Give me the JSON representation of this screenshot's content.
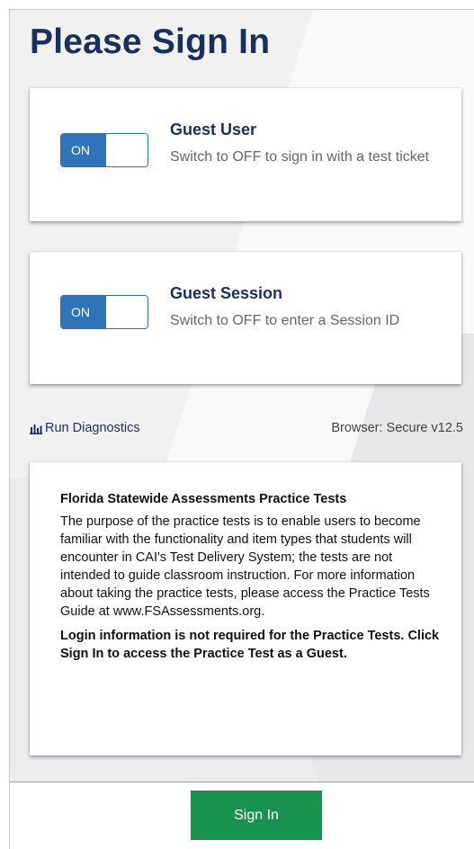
{
  "page": {
    "title": "Please Sign In"
  },
  "guest_user": {
    "toggle_label": "ON",
    "heading": "Guest User",
    "description": "Switch to OFF to sign in with a test ticket",
    "toggle_state": "on"
  },
  "guest_session": {
    "toggle_label": "ON",
    "heading": "Guest Session",
    "description": "Switch to OFF to enter a Session ID",
    "toggle_state": "on"
  },
  "status": {
    "diagnostics_label": "Run Diagnostics",
    "diagnostics_icon": "bar-chart-icon",
    "browser_info": "Browser: Secure v12.5"
  },
  "info": {
    "title": "Florida Statewide Assessments Practice Tests",
    "body": "The purpose of the practice tests is to enable users to become familiar with the functionality and item types that students will encounter in CAI's Test Delivery System; the tests are not intended to guide classroom instruction. For more information about taking the practice tests, please access the Practice Tests Guide at www.FSAssessments.org.",
    "note": "Login information is not required for the Practice Tests. Click Sign In to access the Practice Test as a Guest."
  },
  "footer": {
    "signin_label": "Sign In"
  },
  "colors": {
    "heading": "#1b2f5b",
    "toggle_on": "#2f73b9",
    "signin_button": "#17934f",
    "background": "#f1f1f2"
  }
}
